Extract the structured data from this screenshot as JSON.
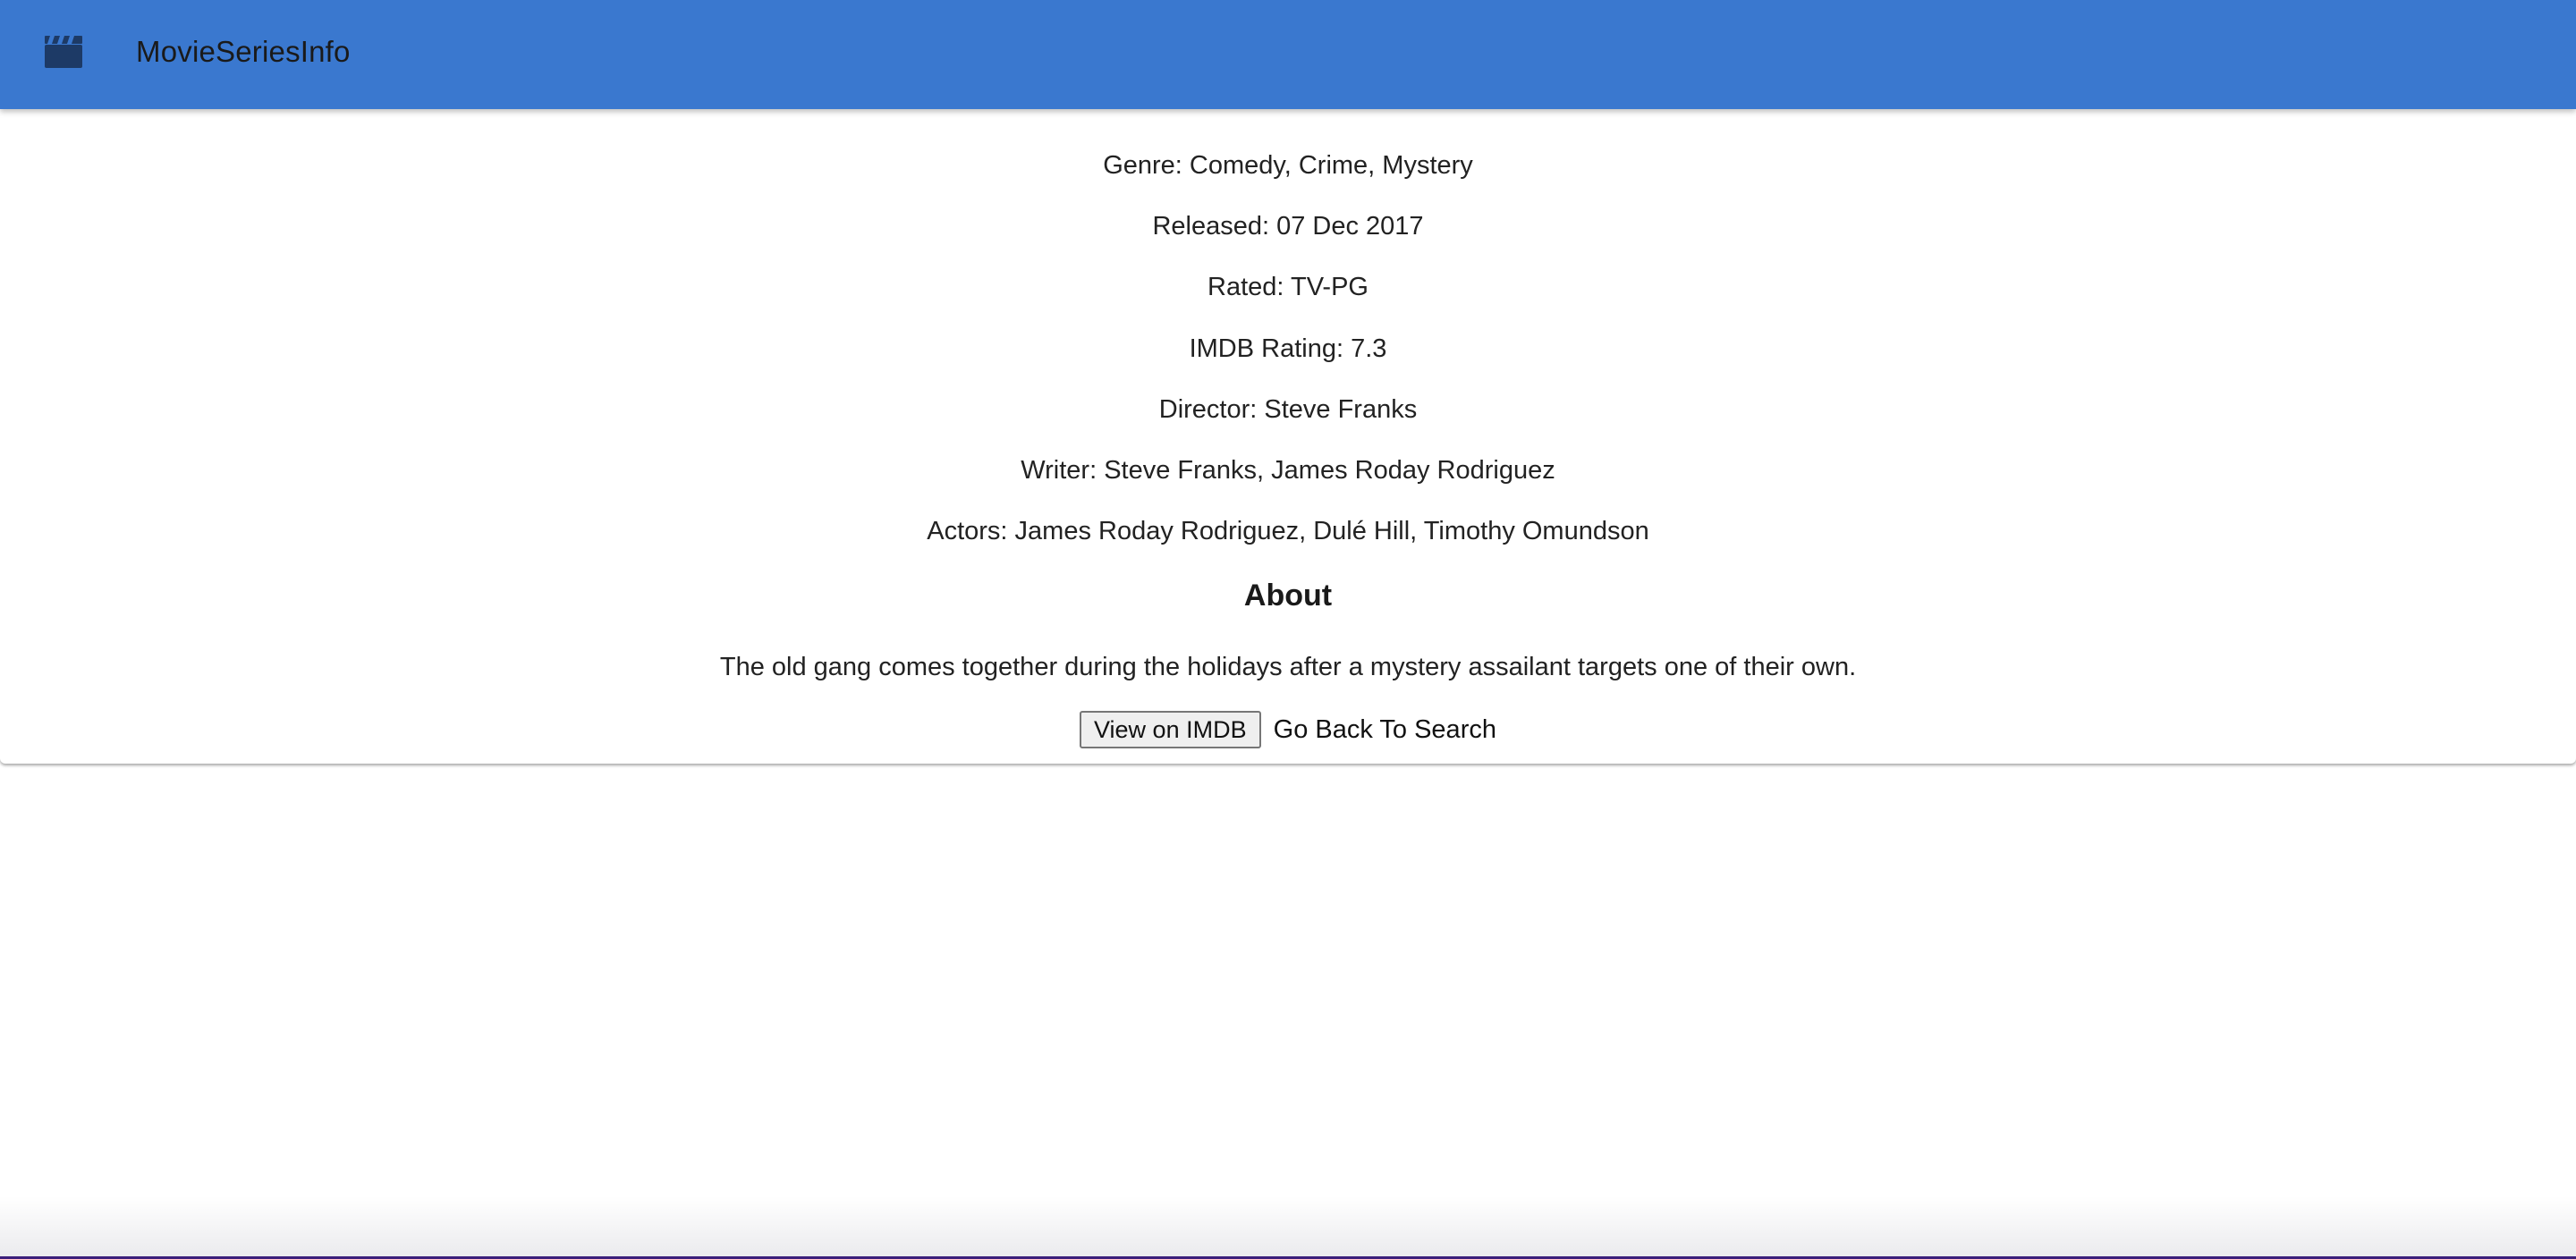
{
  "app": {
    "title": "MovieSeriesInfo",
    "logo_icon": "clapperboard-icon",
    "bar_color": "#3a78cf"
  },
  "details": {
    "genre": "Genre: Comedy, Crime, Mystery",
    "released": "Released: 07 Dec 2017",
    "rated": "Rated: TV-PG",
    "imdb_rating": "IMDB Rating: 7.3",
    "director": "Director: Steve Franks",
    "writer": "Writer: Steve Franks, James Roday Rodriguez",
    "actors": "Actors: James Roday Rodriguez, Dulé Hill, Timothy Omundson"
  },
  "about": {
    "heading": "About",
    "plot": "The old gang comes together during the holidays after a mystery assailant targets one of their own."
  },
  "actions": {
    "imdb_button_label": "View on IMDB",
    "back_link_label": "Go Back To Search"
  }
}
